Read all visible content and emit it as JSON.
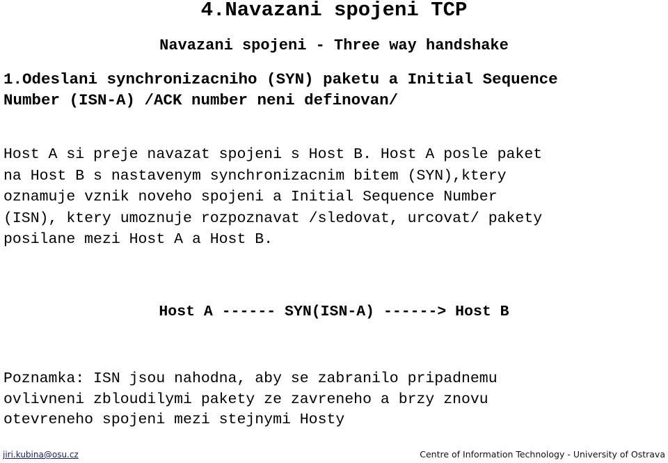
{
  "slide": {
    "title": "4.Navazani spojeni TCP",
    "subtitle": "Navazani spojeni - Three way handshake",
    "section_heading_lines": [
      "1.Odeslani synchronizacniho (SYN) paketu a Initial Sequence",
      "Number (ISN-A) /ACK number neni definovan/"
    ],
    "body_lines": [
      "Host A si preje navazat spojeni s Host B. Host A posle paket",
      "na Host B s nastavenym synchronizacnim bitem (SYN),ktery",
      "oznamuje vznik noveho spojeni a Initial Sequence Number",
      "(ISN), ktery umoznuje rozpoznavat /sledovat, urcovat/ pakety",
      "posilane mezi Host A a Host B."
    ],
    "handshake_line": "Host A ------ SYN(ISN-A) ------> Host B",
    "note_lines": [
      "Poznamka: ISN jsou nahodna, aby se zabranilo pripadnemu",
      "ovlivneni zbloudilymi pakety ze zavreneho a brzy znovu",
      "otevreneho spojeni mezi stejnymi Hosty"
    ]
  },
  "footer": {
    "email": "jiri.kubina@osu.cz",
    "organization": "Centre of Information Technology - University of Ostrava"
  }
}
